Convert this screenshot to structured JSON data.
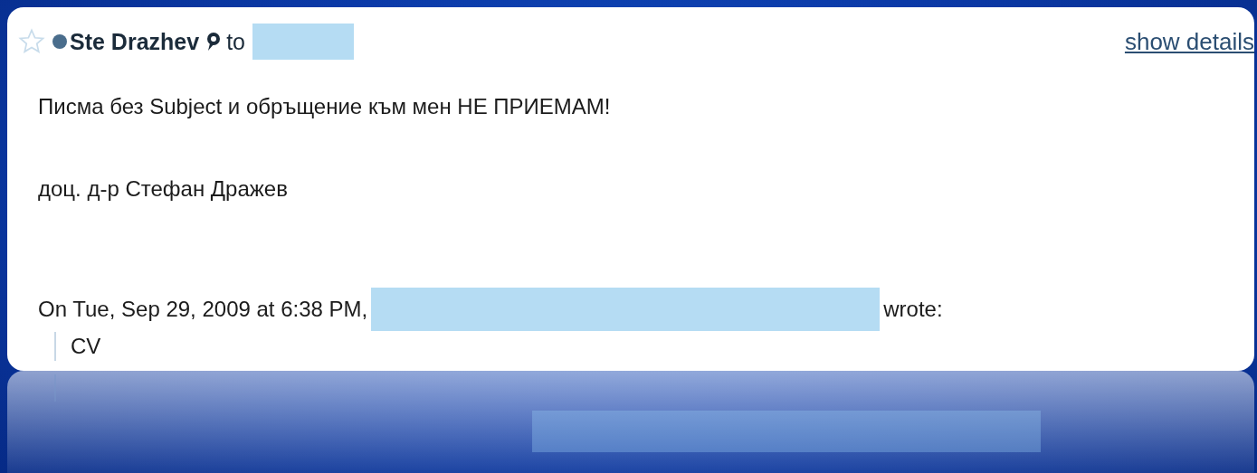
{
  "message": {
    "starred": false,
    "sender": "Ste Drazhev",
    "to_label": "to",
    "show_details": "show details",
    "body": [
      "Писма без Subject и обръщение към мен НЕ ПРИЕМАМ!",
      "доц. д-р Стефан Дражев"
    ],
    "attribution": "On Tue, Sep 29, 2009 at 6:38 PM,",
    "wrote": "wrote:",
    "quote": "CV"
  }
}
